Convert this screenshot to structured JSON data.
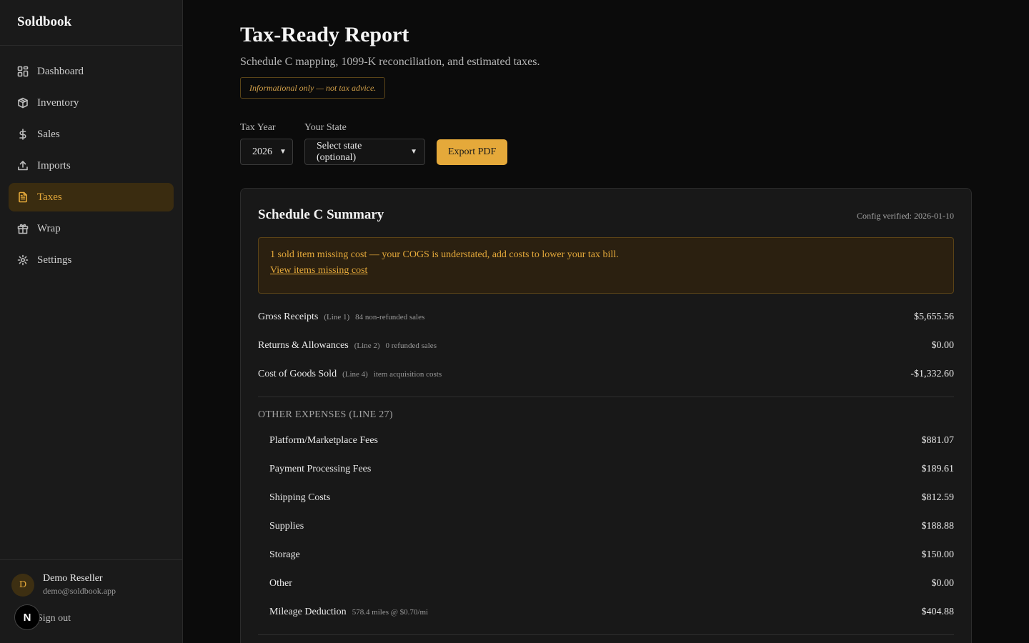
{
  "brand": "Soldbook",
  "nav": [
    {
      "label": "Dashboard",
      "icon": "dashboard-icon"
    },
    {
      "label": "Inventory",
      "icon": "box-icon"
    },
    {
      "label": "Sales",
      "icon": "dollar-icon"
    },
    {
      "label": "Imports",
      "icon": "upload-icon"
    },
    {
      "label": "Taxes",
      "icon": "document-icon"
    },
    {
      "label": "Wrap",
      "icon": "gift-icon"
    },
    {
      "label": "Settings",
      "icon": "gear-icon"
    }
  ],
  "user": {
    "initial": "D",
    "name": "Demo Reseller",
    "email": "demo@soldbook.app",
    "signout": "Sign out",
    "badge": "N"
  },
  "header": {
    "title": "Tax-Ready Report",
    "subtitle": "Schedule C mapping, 1099-K reconciliation, and estimated taxes.",
    "disclaimer": "Informational only — not tax advice."
  },
  "controls": {
    "tax_year_label": "Tax Year",
    "tax_year_value": "2026",
    "state_label": "Your State",
    "state_value": "Select state (optional)",
    "export_label": "Export PDF"
  },
  "summary": {
    "title": "Schedule C Summary",
    "config_note": "Config verified: 2026-01-10",
    "warning": "1 sold item missing cost — your COGS is understated, add costs to lower your tax bill.",
    "warning_link": "View items missing cost",
    "lines": [
      {
        "label": "Gross Receipts",
        "ref": "(Line 1)",
        "note": "84 non-refunded sales",
        "value": "$5,655.56"
      },
      {
        "label": "Returns & Allowances",
        "ref": "(Line 2)",
        "note": "0 refunded sales",
        "value": "$0.00"
      },
      {
        "label": "Cost of Goods Sold",
        "ref": "(Line 4)",
        "note": "item acquisition costs",
        "value": "-$1,332.60"
      }
    ],
    "other_expenses_heading": "OTHER EXPENSES (LINE 27)",
    "expenses": [
      {
        "label": "Platform/Marketplace Fees",
        "note": "",
        "value": "$881.07"
      },
      {
        "label": "Payment Processing Fees",
        "note": "",
        "value": "$189.61"
      },
      {
        "label": "Shipping Costs",
        "note": "",
        "value": "$812.59"
      },
      {
        "label": "Supplies",
        "note": "",
        "value": "$188.88"
      },
      {
        "label": "Storage",
        "note": "",
        "value": "$150.00"
      },
      {
        "label": "Other",
        "note": "",
        "value": "$0.00"
      },
      {
        "label": "Mileage Deduction",
        "note": "578.4 miles @ $0.70/mi",
        "value": "$404.88"
      }
    ]
  }
}
